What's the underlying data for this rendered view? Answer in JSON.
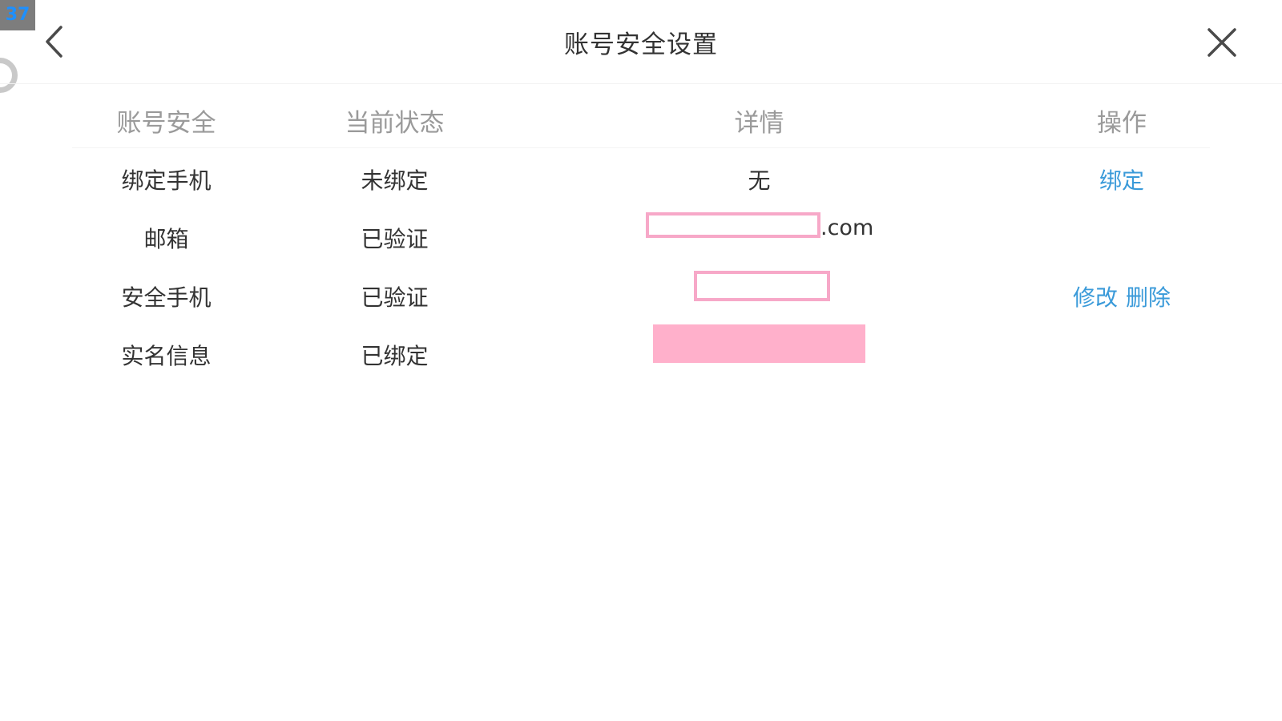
{
  "overlay": {
    "badge": "37"
  },
  "header": {
    "title": "账号安全设置",
    "back_icon": "chevron-left-icon",
    "close_icon": "close-icon"
  },
  "table": {
    "columns": [
      "账号安全",
      "当前状态",
      "详情",
      "操作"
    ],
    "rows": [
      {
        "item": "绑定手机",
        "status": "未绑定",
        "detail": "无",
        "actions": [
          "绑定"
        ]
      },
      {
        "item": "邮箱",
        "status": "已验证",
        "detail_suffix": ".com",
        "actions": []
      },
      {
        "item": "安全手机",
        "status": "已验证",
        "actions": [
          "修改",
          "删除"
        ]
      },
      {
        "item": "实名信息",
        "status": "已绑定",
        "actions": []
      }
    ]
  },
  "colors": {
    "link": "#3a9ad9",
    "redaction": "#ffb0cb",
    "redaction_border": "#f7a8c8"
  }
}
